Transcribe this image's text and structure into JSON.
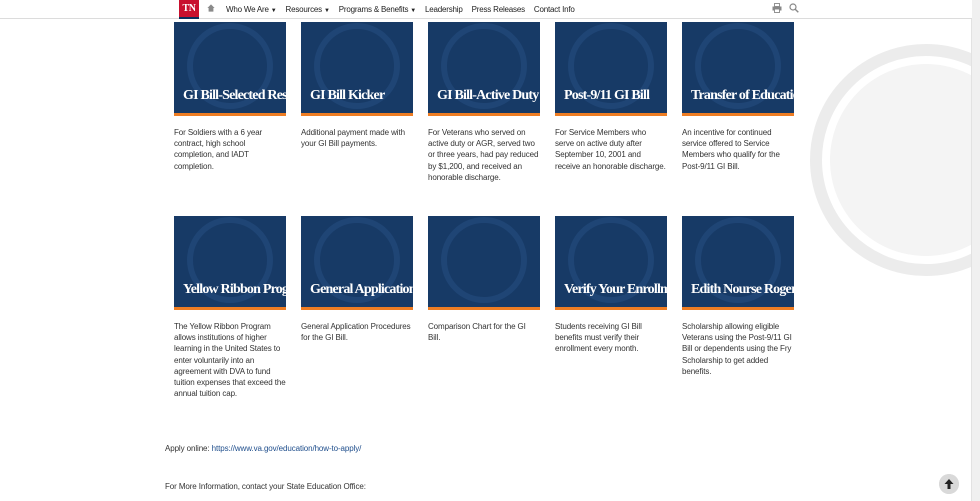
{
  "nav": {
    "logo_text": "TN",
    "items": [
      {
        "label": "Who We Are",
        "dropdown": true
      },
      {
        "label": "Resources",
        "dropdown": true
      },
      {
        "label": "Programs & Benefits",
        "dropdown": true
      },
      {
        "label": "Leadership",
        "dropdown": false
      },
      {
        "label": "Press Releases",
        "dropdown": false
      },
      {
        "label": "Contact Info",
        "dropdown": false
      }
    ],
    "icons": [
      "home-icon",
      "print-icon",
      "search-icon"
    ]
  },
  "colors": {
    "brand_red": "#c8102e",
    "card_blue": "#173a66",
    "card_accent": "#ee7d23",
    "link_blue": "#1f4e8c"
  },
  "cards": [
    {
      "title": "GI Bill-Selected Reserve",
      "description": "For Soldiers with a 6 year contract, high school completion, and IADT completion."
    },
    {
      "title": "GI Bill Kicker",
      "description": "Additional payment made with your GI Bill payments."
    },
    {
      "title": "GI Bill-Active Duty",
      "description": "For Veterans who served on active duty or AGR, served two or three years, had pay reduced by $1,200, and received an honorable discharge."
    },
    {
      "title": "Post-9/11 GI Bill",
      "description": "For Service Members who serve on active duty after September 10, 2001 and receive an honorable discharge."
    },
    {
      "title": "Transfer of Education Benefits",
      "description": "An incentive for continued service offered to Service Members who qualify for the Post-9/11 GI Bill."
    },
    {
      "title": "Yellow Ribbon Program",
      "description": "The Yellow Ribbon Program allows institutions of higher learning in the United States to enter voluntarily into an agreement with DVA to fund tuition expenses that exceed the annual tuition cap."
    },
    {
      "title": "General Application Procedures",
      "description": "General Application Procedures for the GI Bill."
    },
    {
      "title": "",
      "description": "Comparison Chart for the GI Bill."
    },
    {
      "title": "Verify Your Enrollment",
      "description": "Students receiving GI Bill benefits must verify their enrollment every month."
    },
    {
      "title": "Edith Nourse Rogers STEM",
      "description": "Scholarship allowing eligible Veterans using the Post-9/11 GI Bill or dependents using the Fry Scholarship to get added benefits."
    }
  ],
  "footer": {
    "apply_label": "Apply online:",
    "apply_link": "https://www.va.gov/education/how-to-apply/",
    "more_info": "For More Information, contact your State Education Office:"
  }
}
